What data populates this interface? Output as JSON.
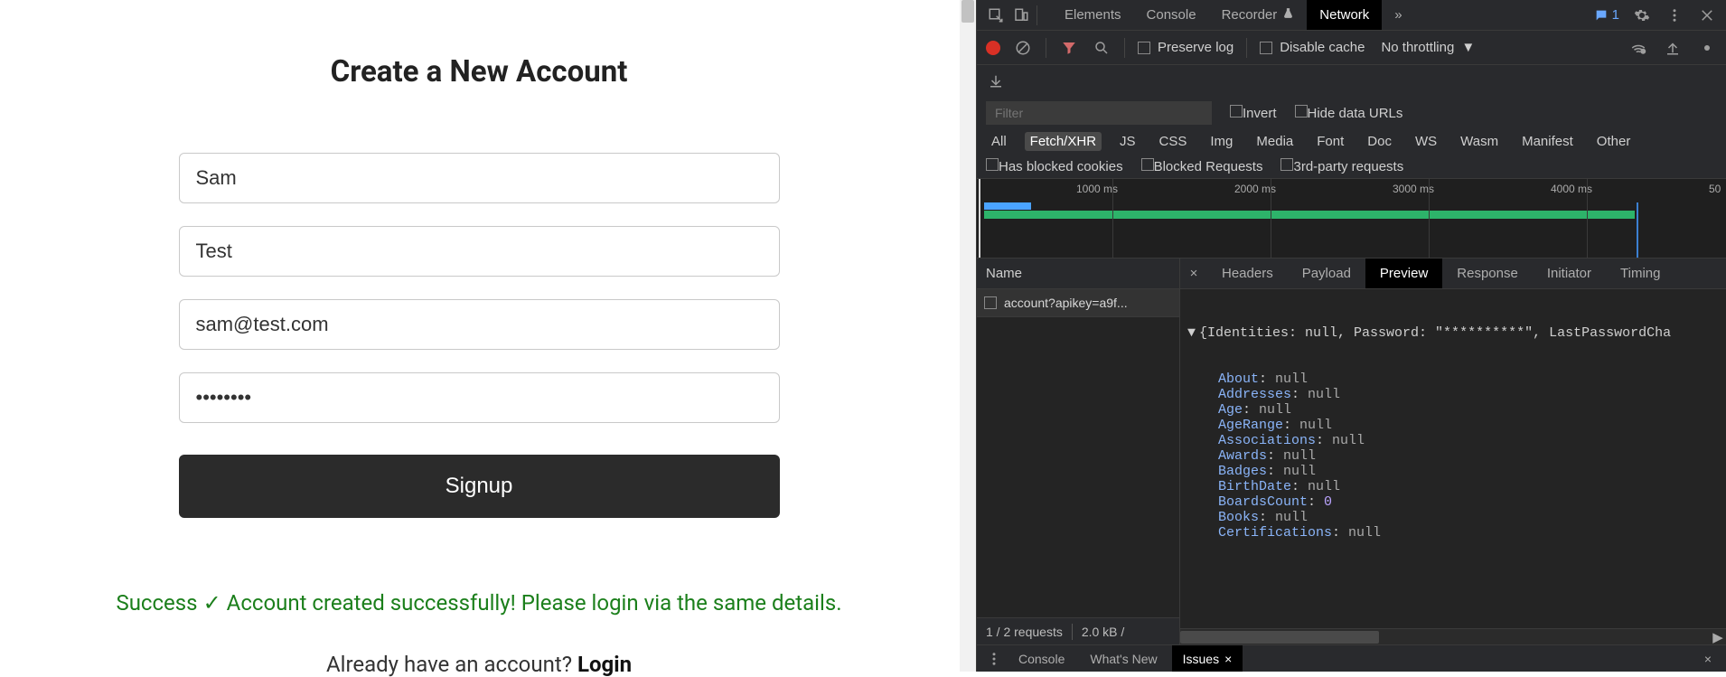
{
  "form": {
    "title": "Create a New Account",
    "first_name": "Sam",
    "last_name": "Test",
    "email": "sam@test.com",
    "password": "••••••••",
    "signup_label": "Signup",
    "success_prefix": "Success",
    "success_check": "✓",
    "success_rest": "Account created successfully! Please login via the same details.",
    "login_prompt": "Already have an account? ",
    "login_label": "Login"
  },
  "devtools": {
    "tabs": {
      "elements": "Elements",
      "console": "Console",
      "recorder": "Recorder",
      "network": "Network",
      "more": "»"
    },
    "issue_count": "1",
    "netbar": {
      "preserve_log": "Preserve log",
      "disable_cache": "Disable cache",
      "throttling": "No throttling"
    },
    "filterbar": {
      "filter_placeholder": "Filter",
      "invert": "Invert",
      "hide_data_urls": "Hide data URLs",
      "types": [
        "All",
        "Fetch/XHR",
        "JS",
        "CSS",
        "Img",
        "Media",
        "Font",
        "Doc",
        "WS",
        "Wasm",
        "Manifest",
        "Other"
      ],
      "active_type_index": 1,
      "has_blocked_cookies": "Has blocked cookies",
      "blocked_requests": "Blocked Requests",
      "third_party": "3rd-party requests"
    },
    "timeline": {
      "ticks": [
        "1000 ms",
        "2000 ms",
        "3000 ms",
        "4000 ms",
        "50"
      ]
    },
    "requests": {
      "name_header": "Name",
      "items": [
        "account?apikey=a9f..."
      ],
      "status": {
        "requests": "1 / 2 requests",
        "transfer": "2.0 kB /"
      }
    },
    "detail_tabs": [
      "Headers",
      "Payload",
      "Preview",
      "Response",
      "Initiator",
      "Timing"
    ],
    "detail_active_index": 2,
    "preview_top": "{Identities: null, Password: \"**********\", LastPasswordCha",
    "preview_props": [
      {
        "k": "About",
        "v": "null",
        "t": "null"
      },
      {
        "k": "Addresses",
        "v": "null",
        "t": "null"
      },
      {
        "k": "Age",
        "v": "null",
        "t": "null"
      },
      {
        "k": "AgeRange",
        "v": "null",
        "t": "null"
      },
      {
        "k": "Associations",
        "v": "null",
        "t": "null"
      },
      {
        "k": "Awards",
        "v": "null",
        "t": "null"
      },
      {
        "k": "Badges",
        "v": "null",
        "t": "null"
      },
      {
        "k": "BirthDate",
        "v": "null",
        "t": "null"
      },
      {
        "k": "BoardsCount",
        "v": "0",
        "t": "num"
      },
      {
        "k": "Books",
        "v": "null",
        "t": "null"
      },
      {
        "k": "Certifications",
        "v": "null",
        "t": "null"
      }
    ],
    "drawer": {
      "console": "Console",
      "whats_new": "What's New",
      "issues": "Issues"
    }
  }
}
